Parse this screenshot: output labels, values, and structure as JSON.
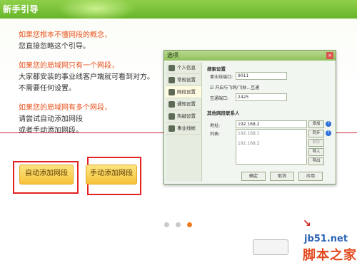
{
  "window": {
    "title": "新手引导"
  },
  "guide": {
    "para1": {
      "line1": "如果您根本不懂网段的概念，",
      "line2": "您直接忽略这个引导。"
    },
    "para2": {
      "line1": "如果您的局域网只有一个网段，",
      "line2": "大家都安装的事业线客户端就可看到对方。",
      "line3": "不需要任何设置。"
    },
    "para3": {
      "line1": "如果您的局域网有多个网段，",
      "line2": "请尝试自动添加网段",
      "line3": "或者手动添加网段。"
    }
  },
  "buttons": {
    "auto_add": "自动添加网段",
    "manual_add": "手动添加网段"
  },
  "dialog": {
    "title": "选项",
    "sidebar": [
      "个人信息",
      "常规设置",
      "网段设置",
      "通知设置",
      "热键设置",
      "事业线帐"
    ],
    "search_header": "搜索设置",
    "port_label": "事业线端口:",
    "port_value": "9011",
    "checkbox_label": "开启与飞鸽/飞秋...互通",
    "mutual_port_label": "互通端口:",
    "mutual_port_value": "2425",
    "other_header": "其他网段联系人",
    "address_label": "地址:",
    "address_value": "192.168.2",
    "list_label": "列表:",
    "list_items": [
      "192.168.1",
      "192.168.2"
    ],
    "add_button": "添加",
    "sync_button": "同步",
    "delete_button": "删除",
    "import_button": "导入",
    "export_button": "导出",
    "ok_button": "确定",
    "cancel_button": "取消",
    "apply_button": "应用"
  },
  "pagination": {
    "total": 3,
    "active": 3
  },
  "watermark": {
    "site": "jb51.net",
    "name": "脚本之家"
  },
  "colors": {
    "accent_red": "#e8521e",
    "highlight_border": "#e32222",
    "title_green": "#68b52a",
    "active_dot": "#f07b1f"
  }
}
